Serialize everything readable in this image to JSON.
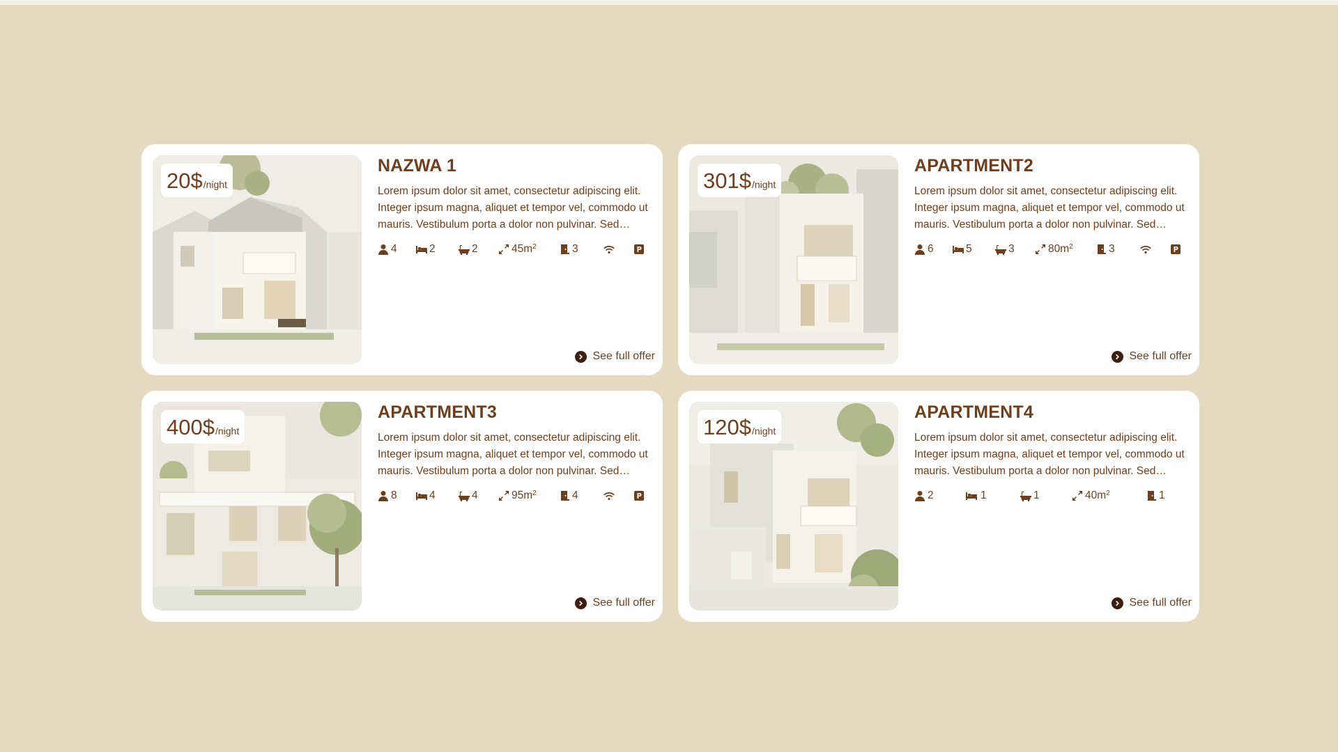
{
  "colors": {
    "background": "#e5d9bf",
    "card": "#ffffff",
    "accent": "#6e3f1d"
  },
  "price_suffix": "/night",
  "offer_label": "See full offer",
  "icons": {
    "guests": "person-icon",
    "beds": "bed-icon",
    "baths": "bathtub-icon",
    "area": "expand-arrows-icon",
    "rooms": "door-icon",
    "wifi": "wifi-icon",
    "parking": "parking-icon"
  },
  "listings": [
    {
      "price": "20$",
      "title": "NAZWA 1",
      "description": "Lorem ipsum dolor sit amet, consectetur adipiscing elit. Integer ipsum magna, aliquet et tempor vel, commodo ut mauris. Vestibulum porta a dolor non pulvinar. Sed…",
      "guests": "4",
      "beds": "2",
      "baths": "2",
      "area": "45m",
      "area_unit": "2",
      "rooms": "3",
      "wifi": true,
      "parking": true
    },
    {
      "price": "301$",
      "title": "APARTMENT2",
      "description": "Lorem ipsum dolor sit amet, consectetur adipiscing elit. Integer ipsum magna, aliquet et tempor vel, commodo ut mauris. Vestibulum porta a dolor non pulvinar. Sed…",
      "guests": "6",
      "beds": "5",
      "baths": "3",
      "area": "80m",
      "area_unit": "2",
      "rooms": "3",
      "wifi": true,
      "parking": true
    },
    {
      "price": "400$",
      "title": "APARTMENT3",
      "description": "Lorem ipsum dolor sit amet, consectetur adipiscing elit. Integer ipsum magna, aliquet et tempor vel, commodo ut mauris. Vestibulum porta a dolor non pulvinar. Sed…",
      "guests": "8",
      "beds": "4",
      "baths": "4",
      "area": "95m",
      "area_unit": "2",
      "rooms": "4",
      "wifi": true,
      "parking": true
    },
    {
      "price": "120$",
      "title": "APARTMENT4",
      "description": "Lorem ipsum dolor sit amet, consectetur adipiscing elit. Integer ipsum magna, aliquet et tempor vel, commodo ut mauris. Vestibulum porta a dolor non pulvinar. Sed…",
      "guests": "2",
      "beds": "1",
      "baths": "1",
      "area": "40m",
      "area_unit": "2",
      "rooms": "1",
      "wifi": false,
      "parking": false
    }
  ]
}
